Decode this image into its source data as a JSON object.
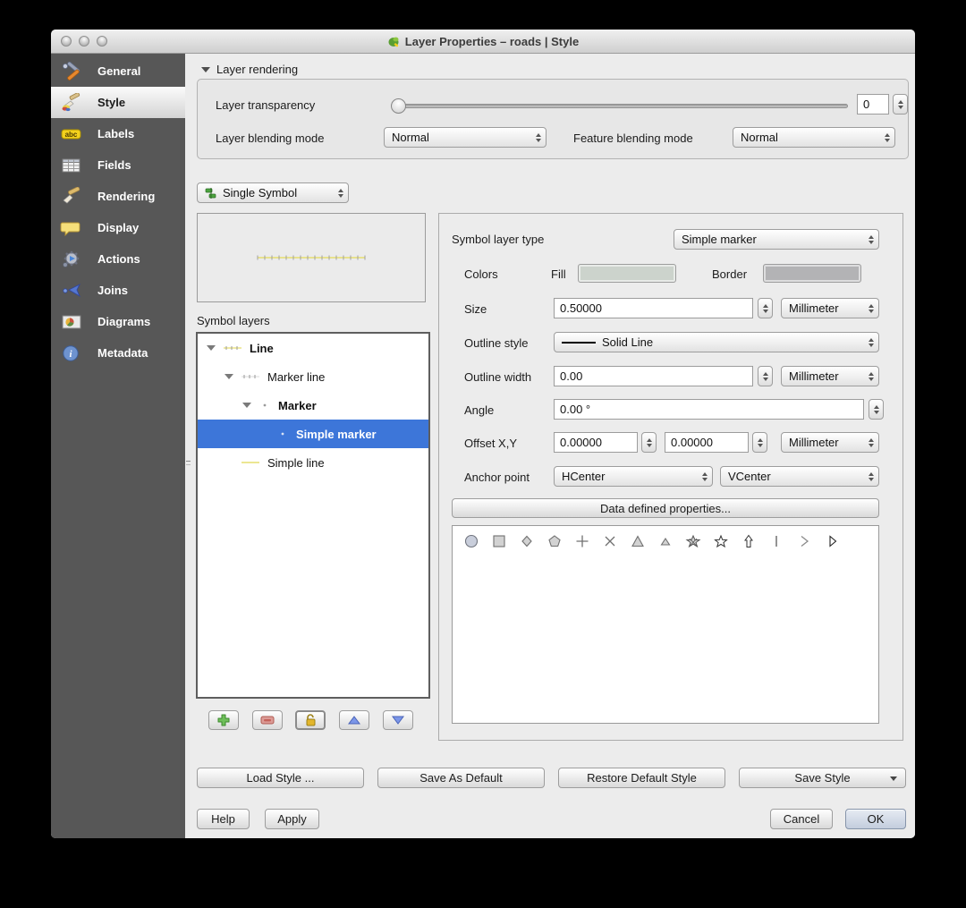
{
  "window": {
    "title": "Layer Properties – roads | Style",
    "traffic_lights": [
      "close",
      "minimize",
      "zoom"
    ]
  },
  "sidebar": {
    "items": [
      {
        "label": "General",
        "icon": "tools-icon"
      },
      {
        "label": "Style",
        "icon": "paintbrush-icon",
        "selected": true
      },
      {
        "label": "Labels",
        "icon": "abc-tag-icon"
      },
      {
        "label": "Fields",
        "icon": "table-icon"
      },
      {
        "label": "Rendering",
        "icon": "brush-icon"
      },
      {
        "label": "Display",
        "icon": "speech-bubble-icon"
      },
      {
        "label": "Actions",
        "icon": "gear-icon"
      },
      {
        "label": "Joins",
        "icon": "join-arrow-icon"
      },
      {
        "label": "Diagrams",
        "icon": "diagram-icon"
      },
      {
        "label": "Metadata",
        "icon": "info-icon"
      }
    ]
  },
  "layer_rendering": {
    "header": "Layer rendering",
    "transparency_label": "Layer transparency",
    "transparency_value": "0",
    "layer_blending_label": "Layer blending mode",
    "layer_blending_value": "Normal",
    "feature_blending_label": "Feature blending mode",
    "feature_blending_value": "Normal"
  },
  "renderer_combo": {
    "value": "Single Symbol"
  },
  "symbol_layers": {
    "label": "Symbol layers",
    "tree": [
      {
        "label": "Line",
        "depth": 0,
        "bold": true,
        "expanded": true
      },
      {
        "label": "Marker line",
        "depth": 1,
        "bold": false,
        "expanded": true
      },
      {
        "label": "Marker",
        "depth": 2,
        "bold": true,
        "expanded": true
      },
      {
        "label": "Simple marker",
        "depth": 3,
        "bold": false,
        "selected": true
      },
      {
        "label": "Simple line",
        "depth": 1,
        "bold": false
      }
    ],
    "toolbar_icons": [
      "add-icon",
      "remove-icon",
      "lock-icon",
      "move-up-icon",
      "move-down-icon"
    ]
  },
  "properties": {
    "symbol_layer_type_label": "Symbol layer type",
    "symbol_layer_type_value": "Simple marker",
    "colors_label": "Colors",
    "fill_label": "Fill",
    "border_label": "Border",
    "size_label": "Size",
    "size_value": "0.50000",
    "size_unit": "Millimeter",
    "outline_style_label": "Outline style",
    "outline_style_value": "Solid Line",
    "outline_width_label": "Outline width",
    "outline_width_value": "0.00",
    "outline_width_unit": "Millimeter",
    "angle_label": "Angle",
    "angle_value": "0.00 °",
    "offset_label": "Offset X,Y",
    "offset_x_value": "0.00000",
    "offset_y_value": "0.00000",
    "offset_unit": "Millimeter",
    "anchor_label": "Anchor point",
    "anchor_h_value": "HCenter",
    "anchor_v_value": "VCenter",
    "data_defined_button": "Data defined properties...",
    "shapes": [
      "circle",
      "square",
      "diamond",
      "pentagon",
      "cross",
      "cross2",
      "triangle",
      "equilateral-triangle",
      "star",
      "regular-star",
      "arrow",
      "line",
      "chevron",
      "arrowhead"
    ]
  },
  "footer": {
    "load_style": "Load Style ...",
    "save_as_default": "Save As Default",
    "restore_default": "Restore Default Style",
    "save_style": "Save Style",
    "help": "Help",
    "apply": "Apply",
    "cancel": "Cancel",
    "ok": "OK"
  },
  "colors": {
    "selection_blue": "#3d76d9",
    "fill_swatch": "#ccd3cc",
    "border_swatch": "#b3b3b5",
    "symbol_line_yellow": "#e6de6e",
    "sidebar_bg": "#575757"
  }
}
